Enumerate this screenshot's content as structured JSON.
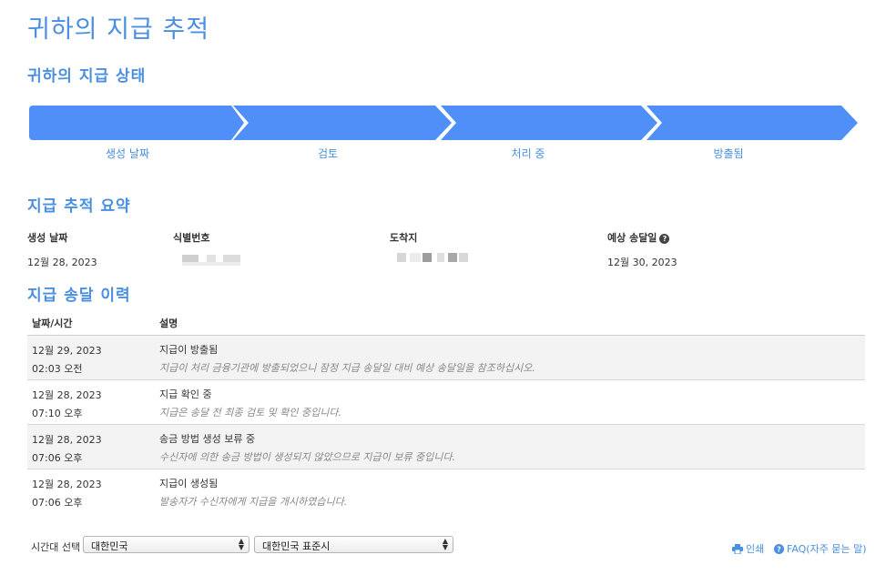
{
  "page_title": "귀하의 지급 추적",
  "status": {
    "title": "귀하의 지급 상태",
    "steps": [
      "생성 날짜",
      "검토",
      "처리 중",
      "방출됨"
    ],
    "accent": "#4f8ff7",
    "current_step": 1
  },
  "summary": {
    "title": "지급 추적 요약",
    "created_label": "생성 날짜",
    "created_value": "12월 28, 2023",
    "id_label": "식별번호",
    "destination_label": "도착지",
    "expected_label": "예상 송달일",
    "expected_value": "12월 30, 2023",
    "help_icon": "question-circle-icon"
  },
  "history": {
    "title": "지급 송달 이력",
    "col_datetime": "날짜/시간",
    "col_desc": "설명",
    "rows": [
      {
        "date": "12월 29, 2023",
        "time": "02:03 오전",
        "title": "지급이 방출됨",
        "desc": "지급이 처리 금융기관에 방출되었으니 잠정 지급 송달일 대비 예상 송달일을 참조하십시오."
      },
      {
        "date": "12월 28, 2023",
        "time": "07:10 오후",
        "title": "지급 확인 중",
        "desc": "지급은 송달 전 최종 검토 및 확인 중입니다."
      },
      {
        "date": "12월 28, 2023",
        "time": "07:06 오후",
        "title": "송금 방법 생성 보류 중",
        "desc": "수신자에 의한 송금 방법이 생성되지 않았으므로 지급이 보류 중입니다."
      },
      {
        "date": "12월 28, 2023",
        "time": "07:06 오후",
        "title": "지급이 생성됨",
        "desc": "발송자가 수신자에게 지급을 개시하였습니다."
      }
    ]
  },
  "footer": {
    "tz_label": "시간대 선택",
    "country": "대한민국",
    "timezone": "대한민국 표준시",
    "print": "인쇄",
    "faq": "FAQ(자주 묻는 말)"
  }
}
